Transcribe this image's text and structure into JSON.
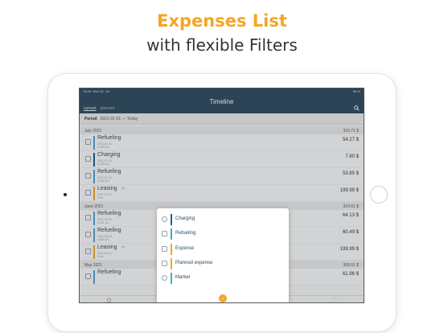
{
  "promo": {
    "title": "Expenses List",
    "subtitle": "with flexible Filters"
  },
  "status": {
    "time": "15:29",
    "date": "Mon 26. Jul",
    "battery": "56 %"
  },
  "header": {
    "title": "Timeline",
    "tabs": [
      "current",
      "planned"
    ]
  },
  "period": {
    "label": "Period",
    "value": "2021-01-01 — Today"
  },
  "months": [
    {
      "name": "July 2021",
      "total": "315.71 $",
      "rows": [
        {
          "title": "Refueling",
          "date": "2021-07-01",
          "sub": "5,150 km",
          "amount": "54.27 $",
          "color": "#4aa3d8",
          "icon": "fuel-icon"
        },
        {
          "title": "Charging",
          "date": "2021-07-03",
          "sub": "5,100 km",
          "amount": "7.60 $",
          "color": "#1f5c8c",
          "icon": "plug-icon"
        },
        {
          "title": "Refueling",
          "date": "2021-07-01",
          "sub": "4,949 km",
          "amount": "53.85 $",
          "color": "#4aa3d8",
          "icon": "fuel-icon"
        },
        {
          "title": "Leasing",
          "date": "2021-07-01",
          "sub": "3 km",
          "amount": "199.99 $",
          "color": "#f5a623",
          "icon": "card-icon",
          "recurring": "⟳"
        }
      ]
    },
    {
      "name": "June 2021",
      "total": "324.61 $",
      "rows": [
        {
          "title": "Refueling",
          "date": "2021-06-20",
          "sub": "4,341 km",
          "amount": "64.13 $",
          "color": "#4aa3d8",
          "icon": "fuel-icon"
        },
        {
          "title": "Refueling",
          "date": "2021-06-05",
          "sub": "3,809 km",
          "amount": "60.49 $",
          "color": "#4aa3d8",
          "icon": "fuel-icon"
        },
        {
          "title": "Leasing",
          "date": "2021-06-01",
          "sub": "3 km",
          "amount": "199.99 $",
          "color": "#f5a623",
          "icon": "card-icon",
          "recurring": "⟳"
        }
      ]
    },
    {
      "name": "May 2021",
      "total": "369.51 $",
      "rows": [
        {
          "title": "Refueling",
          "date": "",
          "sub": "",
          "amount": "61.96 $",
          "color": "#4aa3d8",
          "icon": "fuel-icon"
        }
      ]
    }
  ],
  "filter_menu": {
    "items": [
      {
        "label": "Charging",
        "color": "#1f5c8c",
        "icon": "plug-icon"
      },
      {
        "label": "Refueling",
        "color": "#4aa3d8",
        "icon": "fuel-icon"
      },
      {
        "label": "Expense",
        "color": "#f5a623",
        "icon": "card-icon"
      },
      {
        "label": "Planned expense",
        "color": "#f5a623",
        "icon": "calendar-icon"
      },
      {
        "label": "Marker",
        "color": "#3bb8b0",
        "icon": "pin-icon"
      }
    ],
    "fab_glyph": "⌄"
  },
  "tabbar": {
    "more_glyph": "···"
  }
}
